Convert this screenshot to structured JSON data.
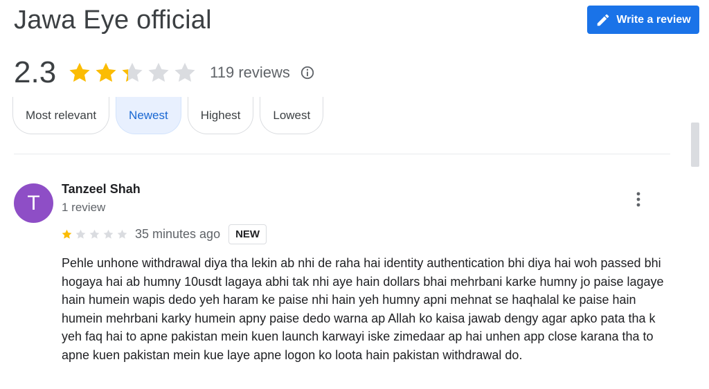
{
  "header": {
    "title": "Jawa Eye official",
    "write_review_label": "Write a review"
  },
  "summary": {
    "rating": "2.3",
    "rating_value": 2.3,
    "max_stars": 5,
    "review_count_text": "119 reviews"
  },
  "sort_chips": [
    {
      "label": "Most relevant",
      "active": false
    },
    {
      "label": "Newest",
      "active": true
    },
    {
      "label": "Highest",
      "active": false
    },
    {
      "label": "Lowest",
      "active": false
    }
  ],
  "review": {
    "avatar_letter": "T",
    "avatar_color": "#8e4ec6",
    "author": "Tanzeel Shah",
    "author_meta": "1 review",
    "stars": 1,
    "time_ago": "35 minutes ago",
    "badge": "NEW",
    "text": "Pehle unhone withdrawal diya tha lekin ab nhi de raha hai identity authentication bhi diya hai woh passed bhi hogaya hai ab humny 10usdt lagaya abhi tak nhi aye hain dollars bhai mehrbani karke humny jo paise lagaye hain humein wapis dedo yeh haram ke paise nhi hain yeh humny apni mehnat se haqhalal ke paise hain humein mehrbani karky humein apny paise dedo warna ap Allah ko kaisa jawab dengy agar apko pata tha k yeh faq hai to apne pakistan mein kuen launch karwayi iske zimedaar ap hai unhen app close karana tha to apne kuen pakistan mein kue laye apne logon ko loota hain pakistan withdrawal do."
  },
  "colors": {
    "accent": "#1a73e8",
    "star_filled": "#fbbc04",
    "star_empty": "#dadce0",
    "active_chip_bg": "#e8f0fe",
    "active_chip_text": "#1967d2"
  },
  "icons": {
    "write": "pencil-icon",
    "info": "info-icon",
    "more": "more-vert-icon",
    "star": "star-icon"
  }
}
